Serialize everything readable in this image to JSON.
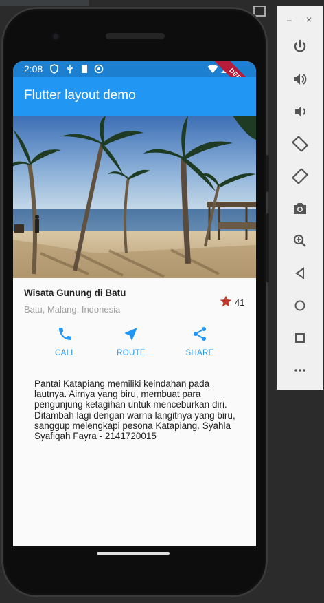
{
  "status_bar": {
    "time": "2:08",
    "debug_label": "DEBUG"
  },
  "app_bar": {
    "title": "Flutter layout demo"
  },
  "place": {
    "name": "Wisata Gunung di Batu",
    "location": "Batu, Malang, Indonesia",
    "favorite_count": "41"
  },
  "actions": [
    {
      "label": "CALL",
      "icon": "phone-icon"
    },
    {
      "label": "ROUTE",
      "icon": "navigation-icon"
    },
    {
      "label": "SHARE",
      "icon": "share-icon"
    }
  ],
  "description": "Pantai Katapiang memiliki keindahan pada lautnya. Airnya yang biru, membuat para pengunjung ketagihan untuk menceburkan diri. Ditambah lagi dengan warna langitnya yang biru, sanggup melengkapi pesona Katapiang. Syahla Syafiqah Fayra - 2141720015",
  "toolbar": {
    "minimize": "–",
    "close": "×",
    "buttons": [
      "power-icon",
      "volume-up-icon",
      "volume-down-icon",
      "rotate-left-icon",
      "rotate-right-icon",
      "camera-icon",
      "zoom-icon",
      "back-icon",
      "home-icon",
      "overview-icon",
      "more-icon"
    ]
  },
  "colors": {
    "primary": "#2196f3",
    "status_bar": "#1c7fcf",
    "star": "#c0392b",
    "debug": "#b71c3a"
  }
}
